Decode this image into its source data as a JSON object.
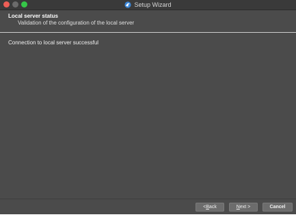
{
  "window": {
    "title": "Setup Wizard",
    "app_icon": "setup-wizard-app-icon"
  },
  "header": {
    "title": "Local server status",
    "subtitle": "Validation of the configuration of the local server"
  },
  "content": {
    "status_message": "Connection to local server successful"
  },
  "buttons": {
    "back": {
      "prefix": "< ",
      "mnemonic": "B",
      "rest": "ack"
    },
    "next": {
      "mnemonic": "N",
      "rest": "ext >"
    },
    "cancel": {
      "label": "Cancel"
    }
  },
  "colors": {
    "background": "#4b4b4b",
    "titlebar": "#3a3a3a",
    "button": "#6c6c6c",
    "close_light": "#ee5e56",
    "zoom_light": "#35c648"
  }
}
